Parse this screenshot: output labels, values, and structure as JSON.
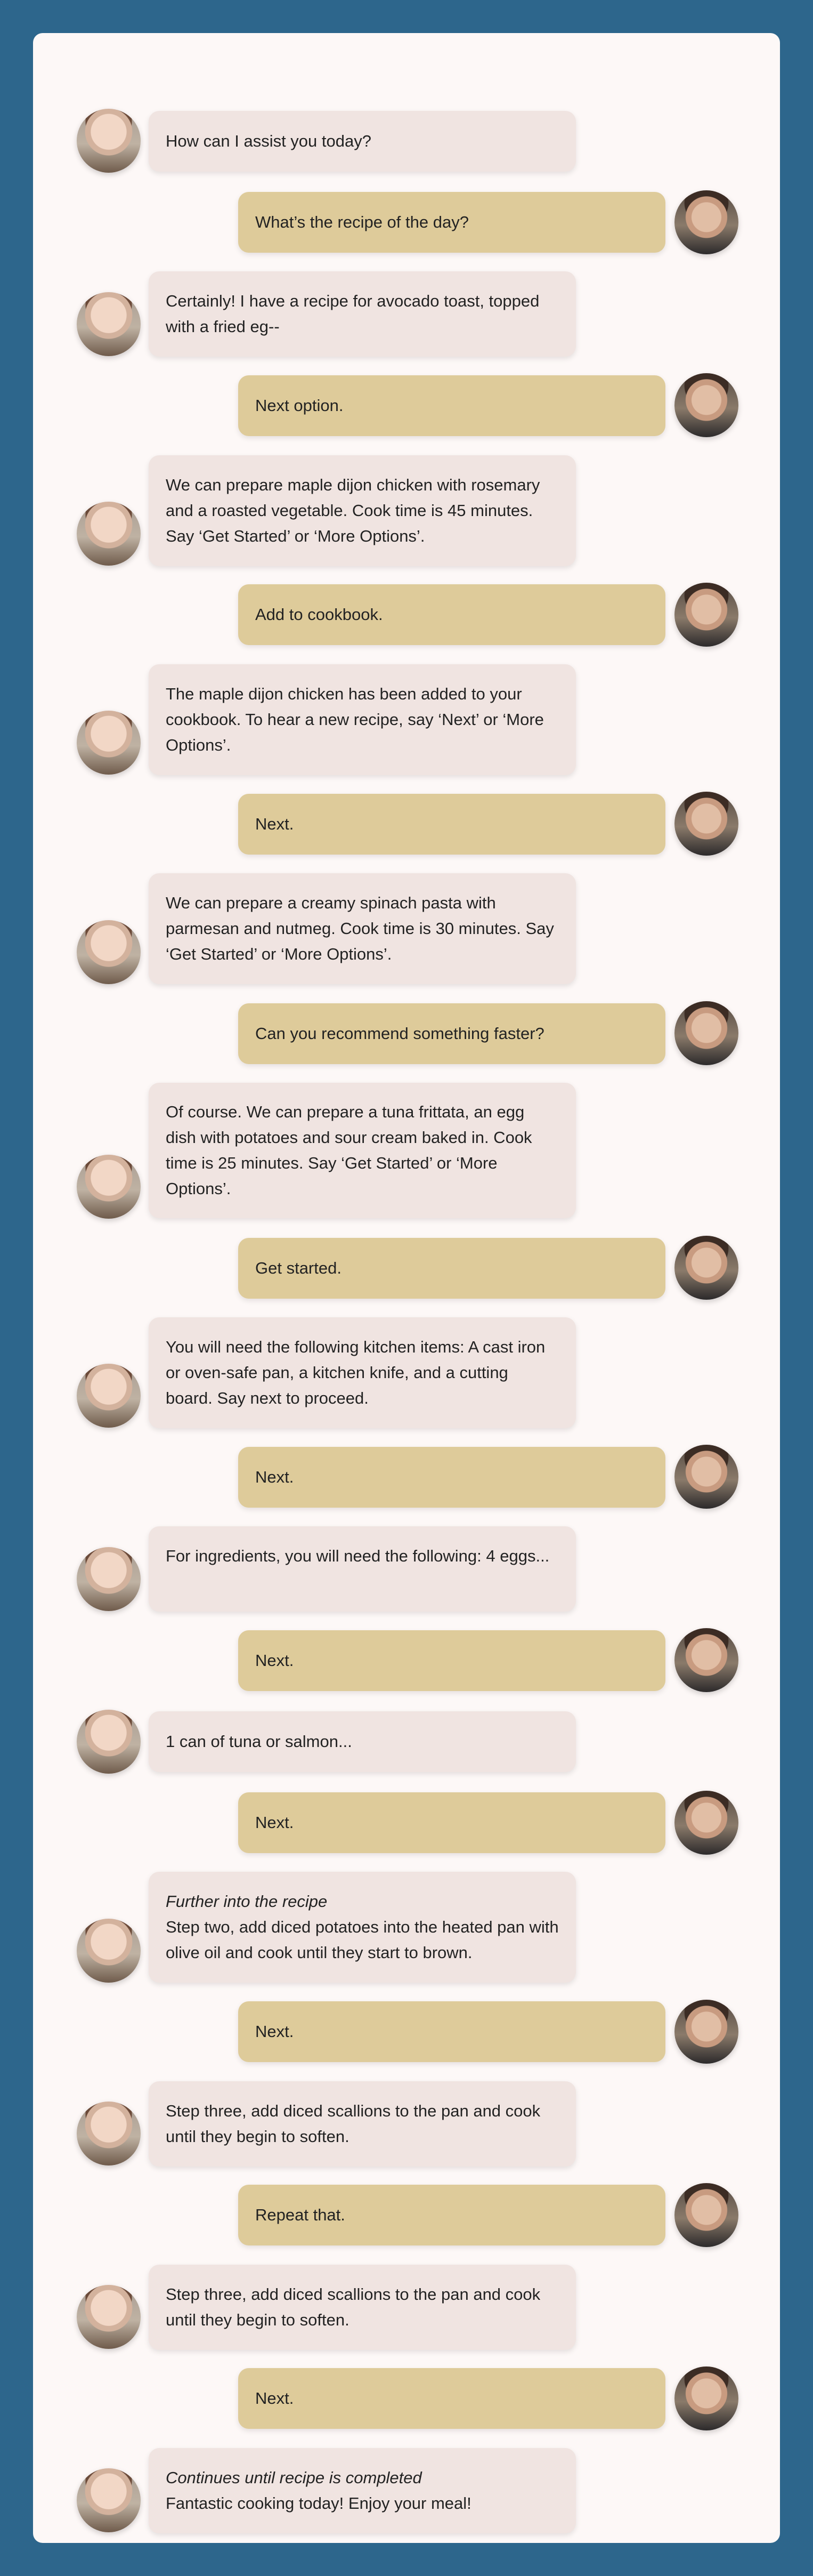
{
  "messages": [
    {
      "role": "assistant",
      "text": "How can I assist you today?"
    },
    {
      "role": "user",
      "text": "What’s the recipe of the day?"
    },
    {
      "role": "assistant",
      "text": "Certainly! I have a recipe for avocado toast, topped with a fried eg--"
    },
    {
      "role": "user",
      "text": "Next option."
    },
    {
      "role": "assistant",
      "text": "We can prepare maple dijon chicken with rosemary and a roasted vegetable. Cook time is 45 minutes. Say ‘Get Started’ or ‘More Options’."
    },
    {
      "role": "user",
      "text": "Add to cookbook."
    },
    {
      "role": "assistant",
      "text": "The maple dijon chicken has been added to your cookbook. To hear a new recipe, say ‘Next’ or ‘More Options’."
    },
    {
      "role": "user",
      "text": "Next."
    },
    {
      "role": "assistant",
      "text": "We can prepare a creamy spinach pasta with parmesan and nutmeg. Cook time is 30 minutes. Say ‘Get Started’ or ‘More Options’."
    },
    {
      "role": "user",
      "text": "Can you recommend something faster?"
    },
    {
      "role": "assistant",
      "text": "Of course. We can prepare a tuna frittata, an egg dish with potatoes and sour cream baked in. Cook time is 25 minutes. Say ‘Get Started’ or ‘More Options’."
    },
    {
      "role": "user",
      "text": "Get started."
    },
    {
      "role": "assistant",
      "text": "You will need the following kitchen items: A cast iron or oven-safe pan, a kitchen knife, and a cutting board. Say next to proceed."
    },
    {
      "role": "user",
      "text": "Next."
    },
    {
      "role": "assistant",
      "text": "For ingredients, you will need the following: 4 eggs..."
    },
    {
      "role": "user",
      "text": "Next."
    },
    {
      "role": "assistant",
      "text": "1 can of tuna or salmon..."
    },
    {
      "role": "user",
      "text": "Next."
    },
    {
      "role": "assistant",
      "note": "Further into the recipe",
      "text": "Step two, add diced potatoes into the heated pan with olive oil and cook until they start to brown."
    },
    {
      "role": "user",
      "text": "Next."
    },
    {
      "role": "assistant",
      "text": "Step three, add diced scallions to the pan and cook until they begin to soften."
    },
    {
      "role": "user",
      "text": "Repeat that."
    },
    {
      "role": "assistant",
      "text": "Step three, add diced scallions to the pan and cook until they begin to soften."
    },
    {
      "role": "user",
      "text": "Next."
    },
    {
      "role": "assistant",
      "note": "Continues until recipe is completed",
      "text": "Fantastic cooking today! Enjoy your meal!"
    }
  ]
}
